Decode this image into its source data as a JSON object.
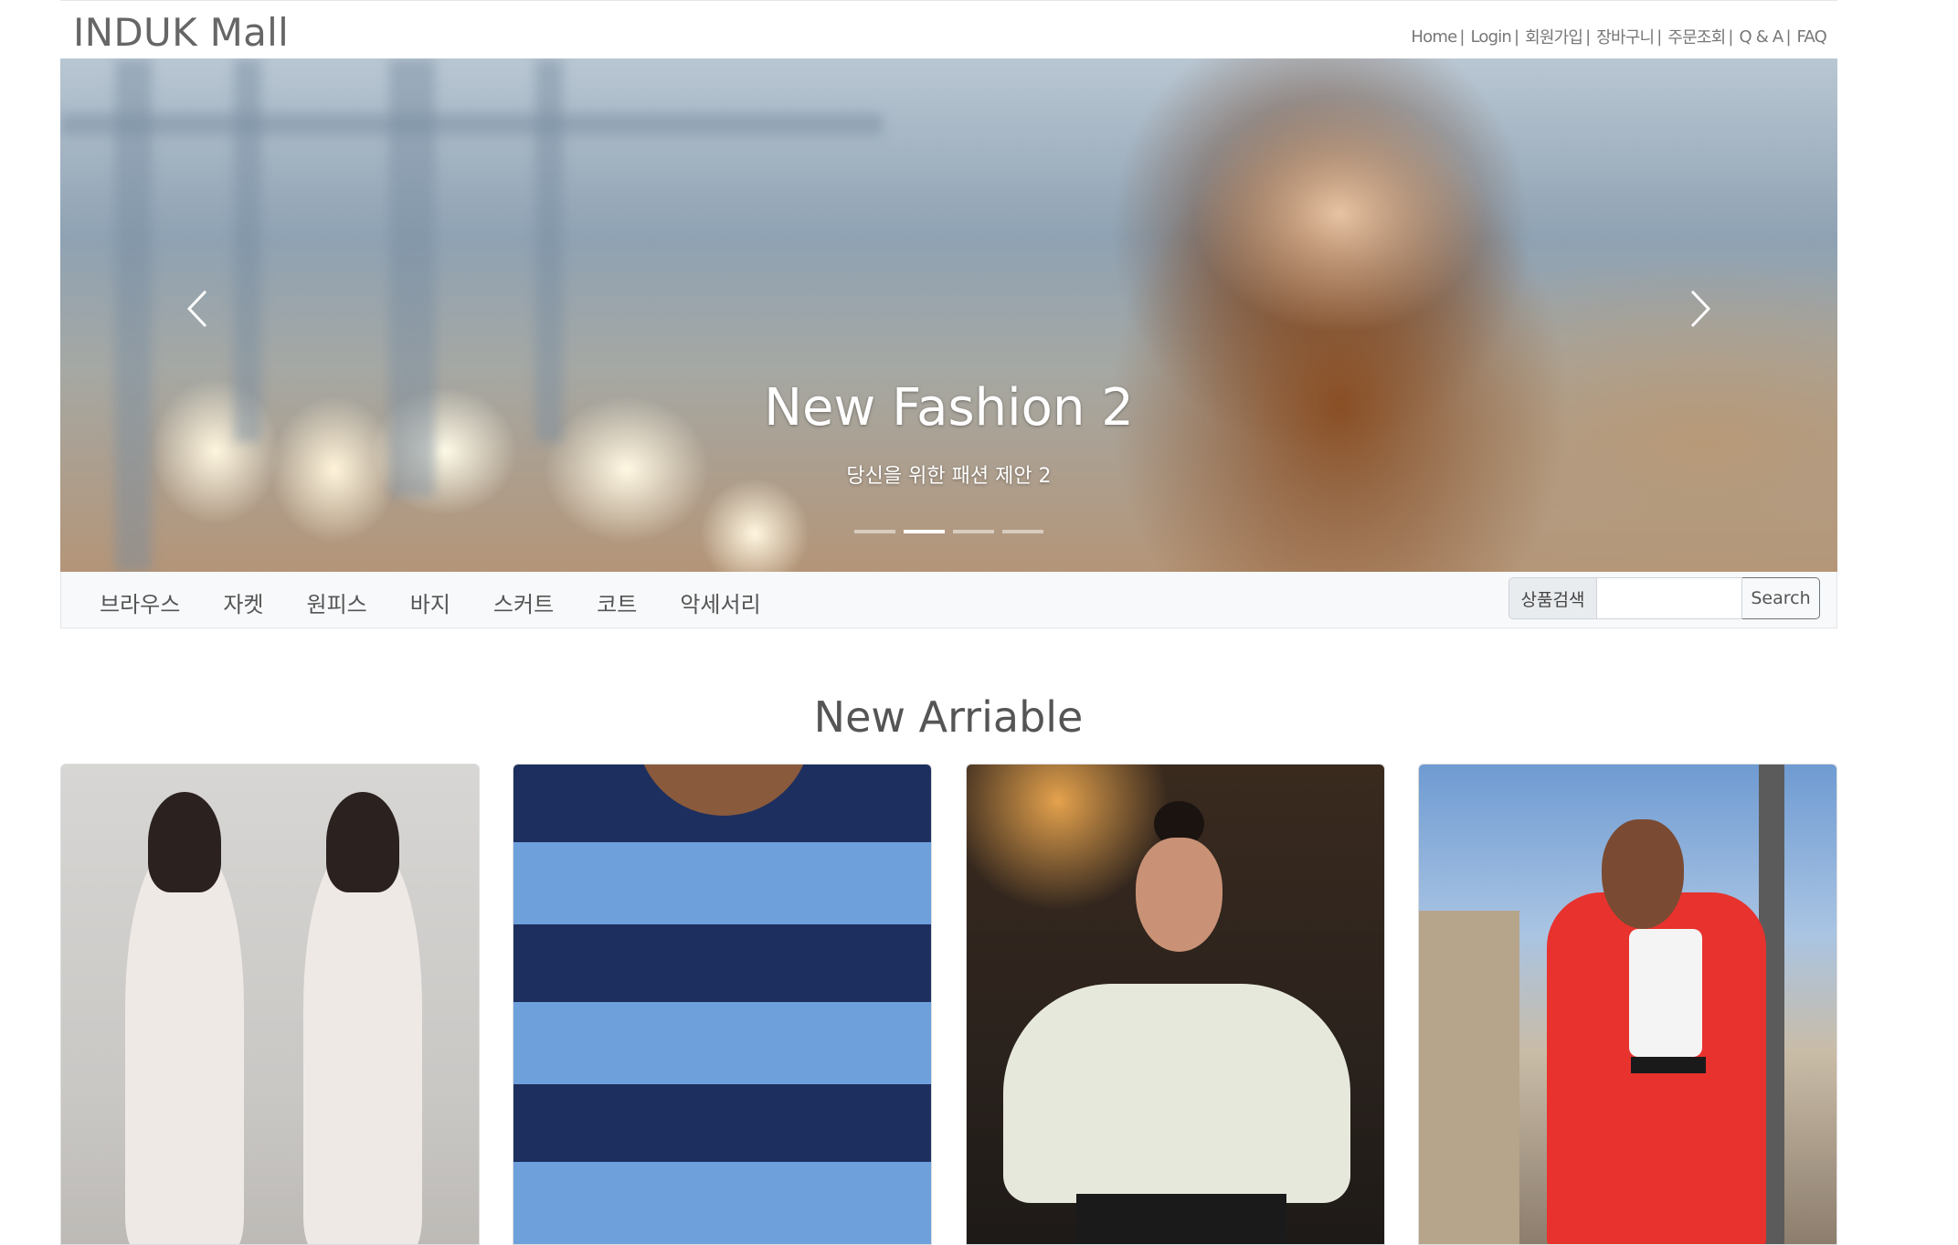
{
  "header": {
    "logo": "INDUK Mall",
    "links": [
      {
        "label": "Home",
        "sep": "|"
      },
      {
        "label": "Login",
        "sep": "|"
      },
      {
        "label": "회원가입",
        "sep": "|"
      },
      {
        "label": "장바구니",
        "sep": "|"
      },
      {
        "label": "주문조회",
        "sep": "|"
      },
      {
        "label": "Q & A",
        "sep": "|"
      },
      {
        "label": "FAQ",
        "sep": ""
      }
    ]
  },
  "carousel": {
    "title": "New Fashion 2",
    "subtitle": "당신을 위한 패션 제안 2",
    "slide_count": 4,
    "active_index": 1,
    "prev_icon": "chevron-left-icon",
    "next_icon": "chevron-right-icon"
  },
  "nav": {
    "categories": [
      "브라우스",
      "자켓",
      "원피스",
      "바지",
      "스커트",
      "코트",
      "악세서리"
    ],
    "search": {
      "label": "상품검색",
      "value": "",
      "placeholder": "",
      "button": "Search"
    }
  },
  "section": {
    "title": "New Arriable"
  },
  "products": [
    {
      "name": "product-white-dress"
    },
    {
      "name": "product-striped-sweater"
    },
    {
      "name": "product-white-blouse"
    },
    {
      "name": "product-red-suit"
    }
  ]
}
